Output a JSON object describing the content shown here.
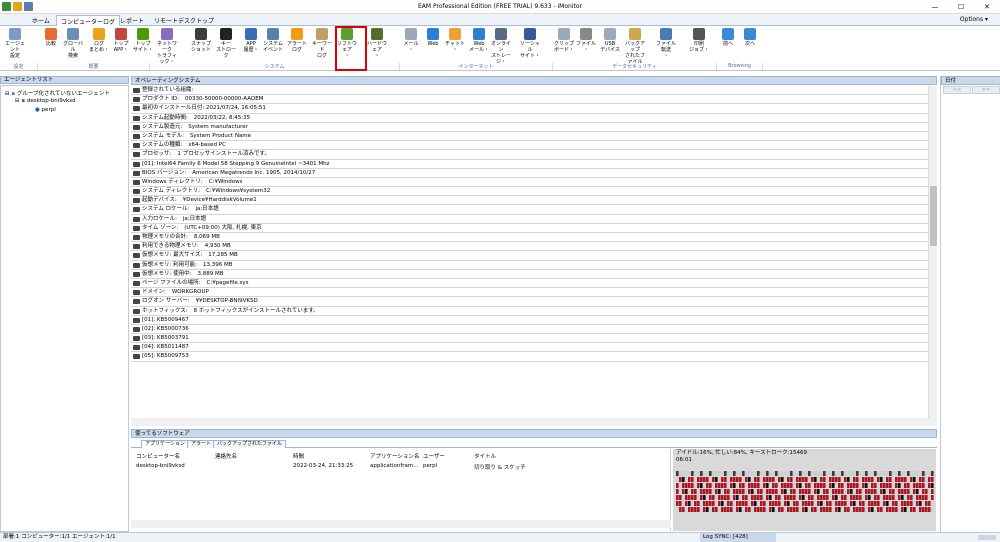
{
  "window": {
    "title": "EAM Professional Edition (FREE TRIAL) 9.633 - iMonitor"
  },
  "menu": {
    "tabs": [
      "ホーム",
      "コンピューターログ",
      "レポート",
      "リモートデスクトップ"
    ],
    "active": 1,
    "options": "Options ▾"
  },
  "ribbon": {
    "buttons": [
      "エージェント\n設定",
      "比較",
      "グローバル\n検索",
      "ログ\nまとめ・",
      "トップ\nAPP・",
      "トップ\nサイト・",
      "ネットワーク\nトラフィック・",
      "スナップ\nショット",
      "キー\nストローク",
      "APP\n履歴・",
      "システム\nイベント",
      "アラート\nログ",
      "キーワード\nログ",
      "ソフトウェア\n・",
      "ハードウェア\n・",
      "メール\n・",
      "Web",
      "チャット\n・",
      "Web\nメール・",
      "オンライン\nストレージ・",
      "ソーシャル\nサイト・",
      "クリップ\nボード・",
      "ファイル\n・",
      "USB\nデバイス",
      "バックアップ\nされたファイル",
      "ファイル転送\n・",
      "印刷\nジョブ・",
      "前へ",
      "次へ"
    ],
    "groups": [
      "設定",
      "概要",
      "システム",
      "インターネット",
      "データセキュリティ",
      "Browsing"
    ]
  },
  "left": {
    "header": "エージェントリスト",
    "nodes": [
      "グループ化されていないエージェント",
      "desktop-bni9vksd",
      "perpl"
    ]
  },
  "main": {
    "header": "オペレーティングシステム",
    "rows": [
      {
        "k": "登録されている組織:",
        "v": ""
      },
      {
        "k": "プロダクト ID:",
        "v": "00330-50000-00000-AAOEM"
      },
      {
        "k": "最初のインストール日付: 2021/07/24, 16:05:51",
        "v": ""
      },
      {
        "k": "システム起動時間:",
        "v": "2022/03/22, 8:45:35"
      },
      {
        "k": "システム製造元:",
        "v": "System manufacturer"
      },
      {
        "k": "システム モデル:",
        "v": "System Product Name"
      },
      {
        "k": "システムの種類:",
        "v": "x64-based PC"
      },
      {
        "k": "プロセッサ:",
        "v": "1 プロセッサインストール済みです。"
      },
      {
        "k": "[01]: Intel64 Family 6 Model 58 Stepping 9 GenuineIntel ~3401 Mhz",
        "v": ""
      },
      {
        "k": "BIOS バージョン:",
        "v": "American Megatrends Inc. 1905, 2014/10/27"
      },
      {
        "k": "Windows ディレクトリ:",
        "v": "C:¥Windows"
      },
      {
        "k": "システム ディレクトリ:",
        "v": "C:¥Windows¥system32"
      },
      {
        "k": "起動デバイス:",
        "v": "¥Device¥HarddiskVolume1"
      },
      {
        "k": "システム ロケール:",
        "v": "ja;日本語"
      },
      {
        "k": "入力ロケール:",
        "v": "ja;日本語"
      },
      {
        "k": "タイム ゾーン:",
        "v": "(UTC+09:00) 大阪, 札幌, 東京"
      },
      {
        "k": "物理メモリの合計:",
        "v": "8,069 MB"
      },
      {
        "k": "利用できる物理メモリ:",
        "v": "4,930 MB"
      },
      {
        "k": "仮想メモリ: 最大サイズ:",
        "v": "17,285 MB"
      },
      {
        "k": "仮想メモリ: 利用可能:",
        "v": "13,396 MB"
      },
      {
        "k": "仮想メモリ: 使用中:",
        "v": "3,889 MB"
      },
      {
        "k": "ページ ファイルの場所:",
        "v": "C:¥pagefile.sys"
      },
      {
        "k": "ドメイン:",
        "v": "WORKGROUP"
      },
      {
        "k": "ログオン サーバー:",
        "v": "¥¥DESKTOP-BNI9VKSD"
      },
      {
        "k": "ホットフィックス:",
        "v": "8 ホットフィックスがインストールされています。"
      },
      {
        "k": "[01]: KB5009467",
        "v": ""
      },
      {
        "k": "[02]: KB5000736",
        "v": ""
      },
      {
        "k": "[03]: KB5003791",
        "v": ""
      },
      {
        "k": "[04]: KB5011487",
        "v": ""
      },
      {
        "k": "[05]: KB5009753",
        "v": ""
      }
    ]
  },
  "bottom": {
    "header": "使ってるソフトウェア",
    "tabs": [
      "アプリケーション",
      "アラート",
      "バックアップされたファイル"
    ],
    "columns": [
      "コンピューター名",
      "連絡先名",
      "時間",
      "アプリケーション名",
      "ユーザー",
      "タイトル"
    ],
    "row": [
      "desktop-bni9vksd",
      "",
      "2022-03-24, 21:33:25",
      "applicationfram...",
      "perpl",
      "切り取り & スケッチ"
    ],
    "thumb_text": "アイドル:16%, 忙しい:84%, キーストローク:15469",
    "thumb_time": "06:01"
  },
  "right": {
    "header": "日付",
    "prev": "<<",
    "next": ">>"
  },
  "status": {
    "left": "部署:1 コンピューター:1/1 エージェント:1/1",
    "sync": "Log SYNC: [428]"
  },
  "colors": {
    "highlight": "#e00000",
    "header": "#c9d8eb",
    "heat_red": "#b0141c",
    "heat_light": "#c8d4e0"
  }
}
